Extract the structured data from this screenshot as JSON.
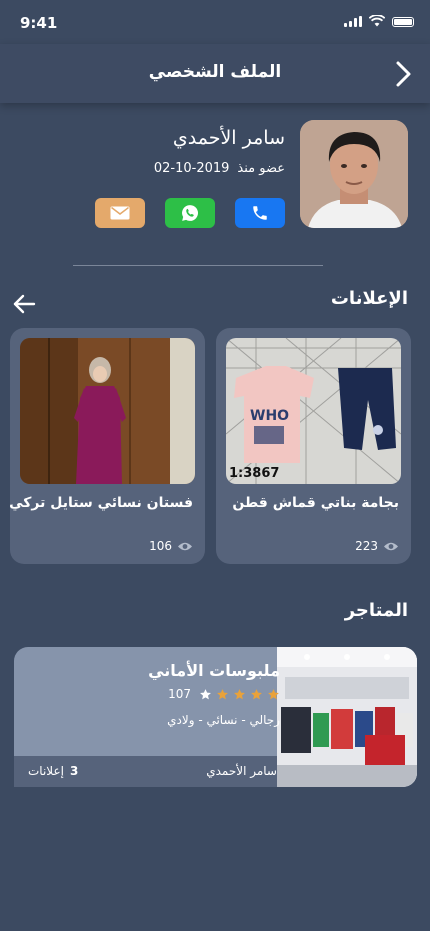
{
  "status_bar": {
    "time": "9:41"
  },
  "header": {
    "title": "الملف الشخصي"
  },
  "profile": {
    "name": "سامر الأحمدي",
    "member_since_label": "عضو منذ",
    "member_since_date": "2019-10-02"
  },
  "contact": {
    "buttons": [
      "phone-icon",
      "whatsapp-icon",
      "email-icon"
    ],
    "colors": {
      "phone": "#1877f2",
      "whatsapp": "#2dbf47",
      "email": "#e4a96b"
    }
  },
  "ads": {
    "title": "الإعلانات",
    "items": [
      {
        "title": "بجامة بناتي قماش قطن",
        "views": "223",
        "image_text": "1:3867"
      },
      {
        "title": "فستان نسائي ستايل تركي",
        "views": "106"
      }
    ]
  },
  "stores": {
    "title": "المتاجر",
    "items": [
      {
        "name": "ملبوسات الأماني",
        "rating_count": "107",
        "rating": 4,
        "rating_max": 5,
        "categories": "رجالي - نسائي - ولادي",
        "owner": "سامر الأحمدي",
        "ads_count": "3",
        "ads_label": "إعلانات"
      }
    ]
  },
  "theme": {
    "background": "#3c4a61",
    "card": "#56637b",
    "star": "#e9a23b"
  }
}
